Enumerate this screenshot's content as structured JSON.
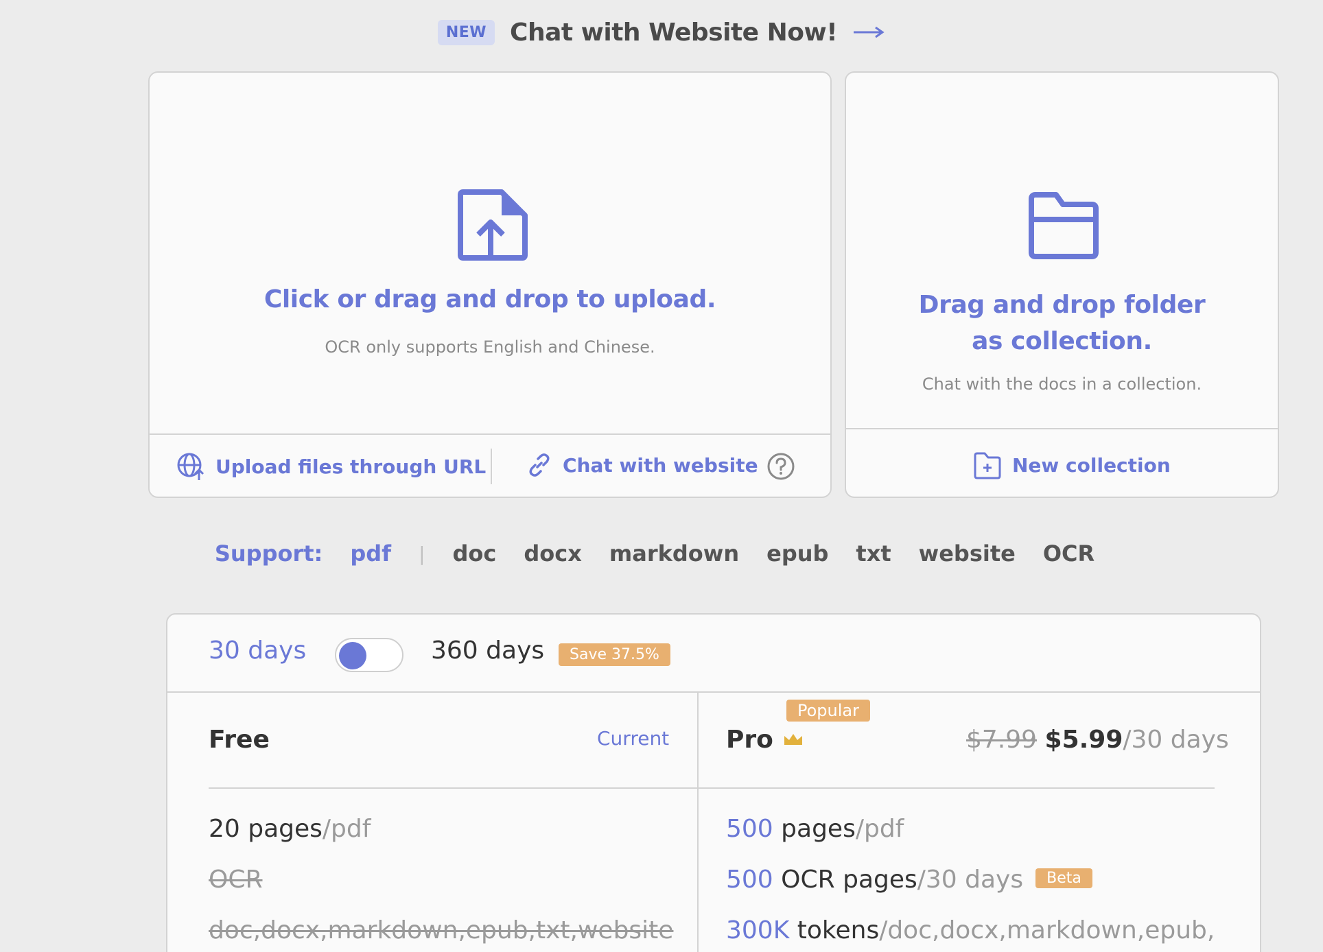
{
  "banner": {
    "badge": "NEW",
    "title": "Chat with Website Now!",
    "arrow_icon": "arrow-right-icon"
  },
  "upload": {
    "icon": "file-upload-icon",
    "title": "Click or drag and drop to upload.",
    "subtitle": "OCR only supports English and Chinese.",
    "url_link": "Upload files through URL",
    "url_icon": "globe-upload-icon",
    "website_link": "Chat with website",
    "website_icon": "link-icon",
    "help_icon": "question-circle-icon"
  },
  "collection": {
    "icon": "folder-icon",
    "title_line1": "Drag and drop folder",
    "title_line2": "as collection.",
    "subtitle": "Chat with the docs in a collection.",
    "new_link": "New collection",
    "new_icon": "folder-plus-icon"
  },
  "support": {
    "label": "Support:",
    "active": "pdf",
    "separator": "|",
    "items": [
      "doc",
      "docx",
      "markdown",
      "epub",
      "txt",
      "website",
      "OCR"
    ]
  },
  "pricing": {
    "period_30": "30 days",
    "period_360": "360 days",
    "save_badge": "Save 37.5%",
    "toggle_state": "30 days",
    "free": {
      "title": "Free",
      "status": "Current",
      "feature1_main": "20 pages",
      "feature1_unit": "/pdf",
      "feature2": "OCR",
      "feature3": "doc,docx,markdown,epub,txt,website"
    },
    "pro": {
      "title": "Pro",
      "crown_icon": "crown-icon",
      "popular_badge": "Popular",
      "price_old": "$7.99",
      "price_new": "$5.99",
      "price_period": "/30 days",
      "feature1_num": "500",
      "feature1_main": " pages",
      "feature1_unit": "/pdf",
      "feature2_num": "500",
      "feature2_main": " OCR pages",
      "feature2_unit": "/30 days",
      "beta_badge": "Beta",
      "feature3_num": "300K",
      "feature3_main": " tokens",
      "feature3_unit": "/doc,docx,markdown,epub,"
    }
  },
  "colors": {
    "accent": "#6a78d6",
    "badge_orange": "#e8b070",
    "background": "#ececec"
  }
}
